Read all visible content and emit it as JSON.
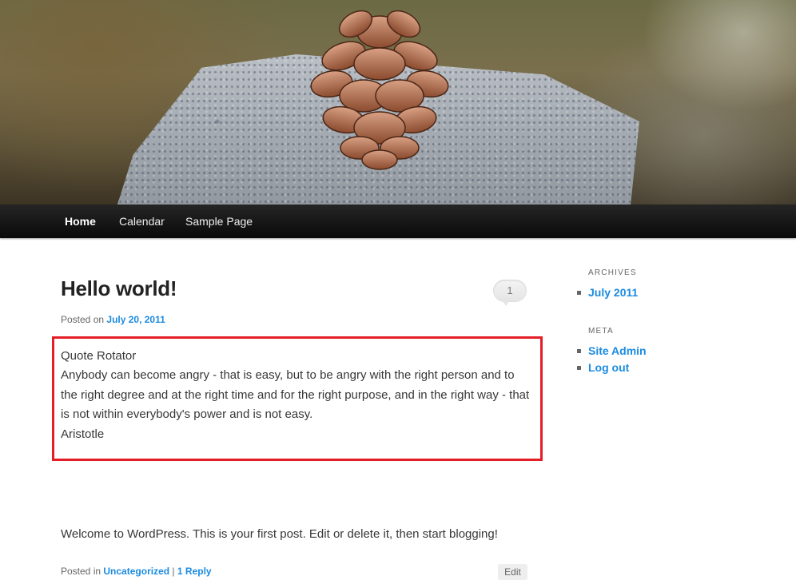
{
  "nav": {
    "items": [
      {
        "label": "Home",
        "current": true
      },
      {
        "label": "Calendar",
        "current": false
      },
      {
        "label": "Sample Page",
        "current": false
      }
    ]
  },
  "post": {
    "title": "Hello world!",
    "comment_count": "1",
    "posted_on_label": "Posted on",
    "date": "July 20, 2011",
    "quote": {
      "heading": "Quote Rotator",
      "text": "Anybody can become angry - that is easy, but to be angry with the right person and to the right degree and at the right time and for the right purpose, and in the right way - that is not within everybody's power and is not easy.",
      "author": "Aristotle"
    },
    "body": "Welcome to WordPress. This is your first post. Edit or delete it, then start blogging!",
    "footer": {
      "posted_in_label": "Posted in",
      "category": "Uncategorized",
      "separator": "|",
      "reply_link": "1 Reply",
      "edit_label": "Edit"
    }
  },
  "sidebar": {
    "archives": {
      "title": "ARCHIVES",
      "items": [
        "July 2011"
      ]
    },
    "meta": {
      "title": "META",
      "items": [
        "Site Admin",
        "Log out"
      ]
    }
  },
  "colors": {
    "link": "#1b8be0",
    "highlight_border": "#e41e26",
    "nav_background": "#111111"
  }
}
